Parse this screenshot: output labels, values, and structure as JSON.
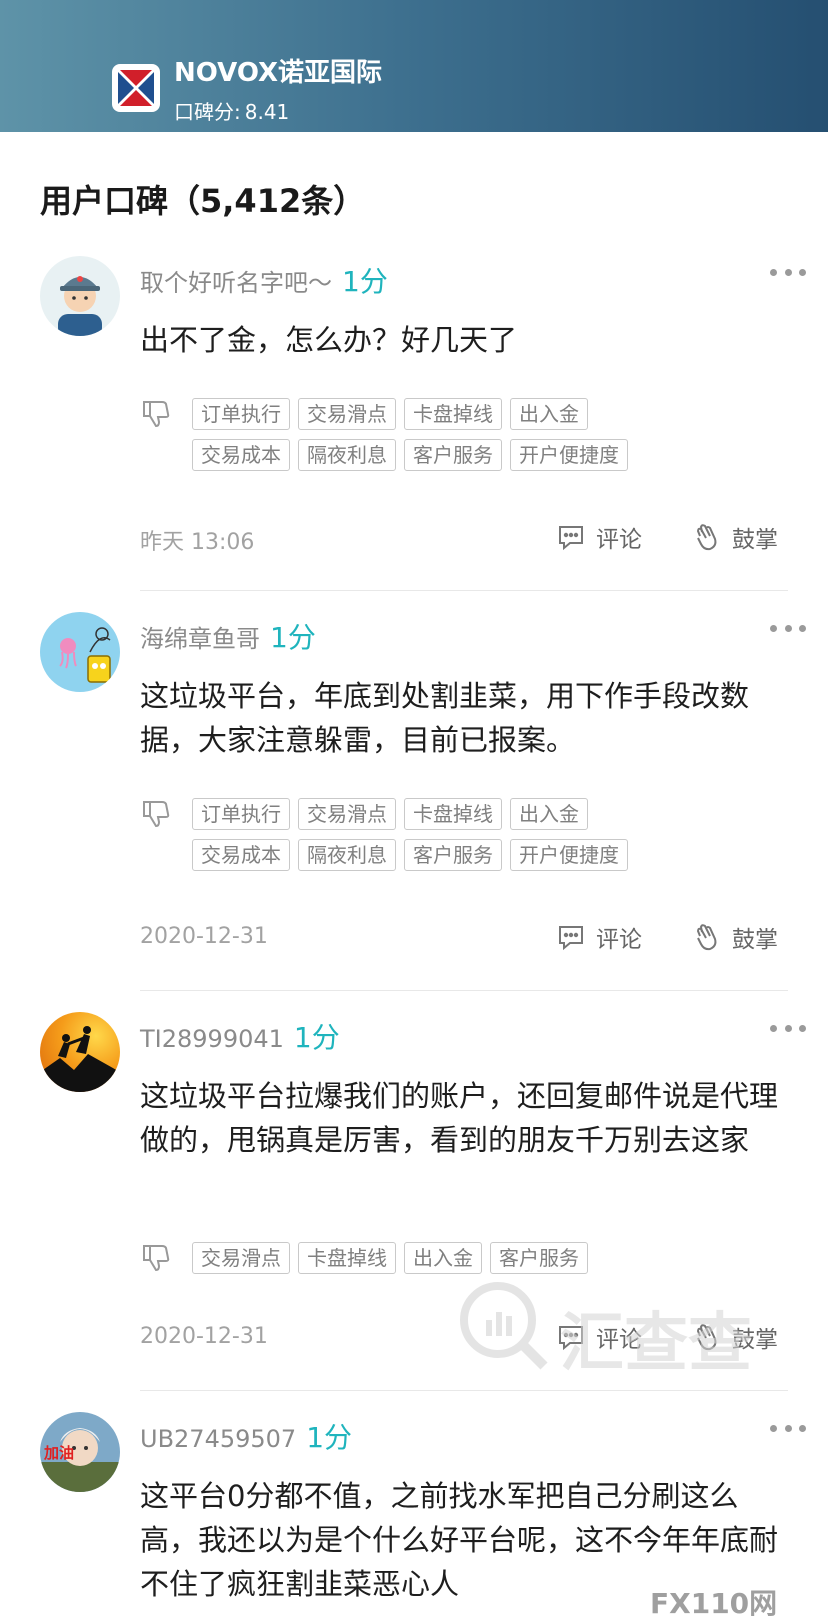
{
  "header": {
    "brand_name": "NOVOX诺亚国际",
    "score_label": "口碑分:",
    "score_value": "8.41"
  },
  "section_title": "用户口碑（5,412条）",
  "actions": {
    "comment": "评论",
    "applaud": "鼓掌"
  },
  "reviews": [
    {
      "username": "取个好听名字吧～",
      "score": "1分",
      "content": "出不了金，怎么办？好几天了",
      "tags_row1": [
        "订单执行",
        "交易滑点",
        "卡盘掉线",
        "出入金"
      ],
      "tags_row2": [
        "交易成本",
        "隔夜利息",
        "客户服务",
        "开户便捷度"
      ],
      "date": "昨天 13:06"
    },
    {
      "username": "海绵章鱼哥",
      "score": "1分",
      "content": "这垃圾平台，年底到处割韭菜，用下作手段改数据，大家注意躲雷，目前已报案。",
      "tags_row1": [
        "订单执行",
        "交易滑点",
        "卡盘掉线",
        "出入金"
      ],
      "tags_row2": [
        "交易成本",
        "隔夜利息",
        "客户服务",
        "开户便捷度"
      ],
      "date": "2020-12-31"
    },
    {
      "username": "TI28999041",
      "score": "1分",
      "content": "这垃圾平台拉爆我们的账户，还回复邮件说是代理做的，甩锅真是厉害，看到的朋友千万别去这家",
      "tags_row1": [
        "交易滑点",
        "卡盘掉线",
        "出入金",
        "客户服务"
      ],
      "date": "2020-12-31"
    },
    {
      "username": "UB27459507",
      "score": "1分",
      "content": "这平台0分都不值，之前找水军把自己分刷这么高，我还以为是个什么好平台呢，这不今年年底耐不住了疯狂割韭菜恶心人",
      "avatar_text": "加油"
    }
  ],
  "watermark": {
    "text": "汇查查",
    "corner": "FX110网"
  },
  "colors": {
    "accent": "#1fb4bd",
    "header_start": "#5e93a8",
    "header_end": "#254f71"
  }
}
